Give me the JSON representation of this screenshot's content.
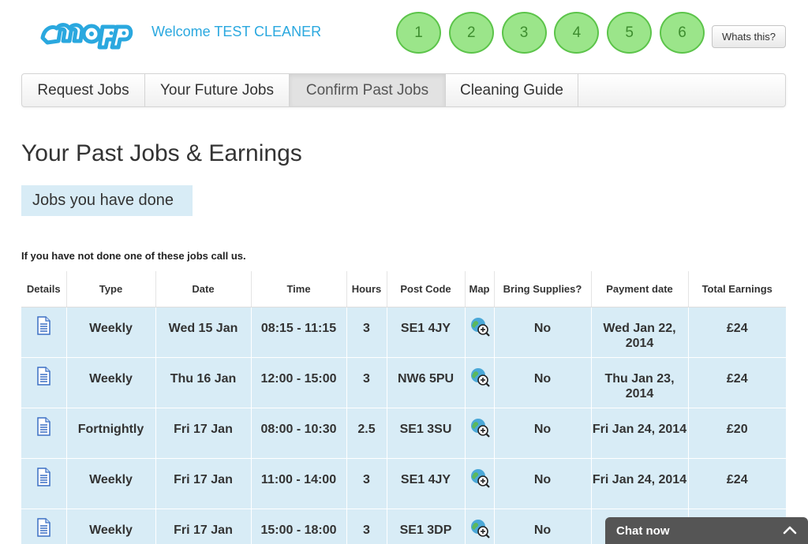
{
  "header": {
    "welcome": "Welcome TEST CLEANER",
    "steps": [
      "1",
      "2",
      "3",
      "4",
      "5",
      "6"
    ],
    "whats_this": "Whats this?"
  },
  "nav": {
    "items": [
      "Request Jobs",
      "Your Future Jobs",
      "Confirm Past Jobs",
      "Cleaning Guide"
    ],
    "active": "Confirm Past Jobs"
  },
  "main": {
    "title": "Your Past Jobs & Earnings",
    "subheading": "Jobs you have done",
    "notice": "If you have not done one of these jobs call us."
  },
  "table": {
    "columns": [
      "Details",
      "Type",
      "Date",
      "Time",
      "Hours",
      "Post Code",
      "Map",
      "Bring Supplies?",
      "Payment date",
      "Total Earnings"
    ],
    "rows": [
      {
        "type": "Weekly",
        "date": "Wed 15 Jan",
        "time": "08:15 - 11:15",
        "hours": "3",
        "postcode": "SE1 4JY",
        "supplies": "No",
        "payment_date": "Wed Jan 22, 2014",
        "earnings": "£24"
      },
      {
        "type": "Weekly",
        "date": "Thu 16 Jan",
        "time": "12:00 - 15:00",
        "hours": "3",
        "postcode": "NW6 5PU",
        "supplies": "No",
        "payment_date": "Thu Jan 23, 2014",
        "earnings": "£24"
      },
      {
        "type": "Fortnightly",
        "date": "Fri 17 Jan",
        "time": "08:00 - 10:30",
        "hours": "2.5",
        "postcode": "SE1 3SU",
        "supplies": "No",
        "payment_date": "Fri Jan 24, 2014",
        "earnings": "£20"
      },
      {
        "type": "Weekly",
        "date": "Fri 17 Jan",
        "time": "11:00 - 14:00",
        "hours": "3",
        "postcode": "SE1 4JY",
        "supplies": "No",
        "payment_date": "Fri Jan 24, 2014",
        "earnings": "£24"
      },
      {
        "type": "Weekly",
        "date": "Fri 17 Jan",
        "time": "15:00 - 18:00",
        "hours": "3",
        "postcode": "SE1 3DP",
        "supplies": "No",
        "payment_date": "",
        "earnings": ""
      }
    ]
  },
  "chat": {
    "label": "Chat now"
  },
  "icons": {
    "details": "document-icon",
    "map": "map-zoom-icon",
    "chat_toggle": "chevron-up-icon"
  },
  "colors": {
    "brand_blue": "#2aa8df",
    "step_green": "#9be58a",
    "row_blue": "#d8ecf6"
  }
}
